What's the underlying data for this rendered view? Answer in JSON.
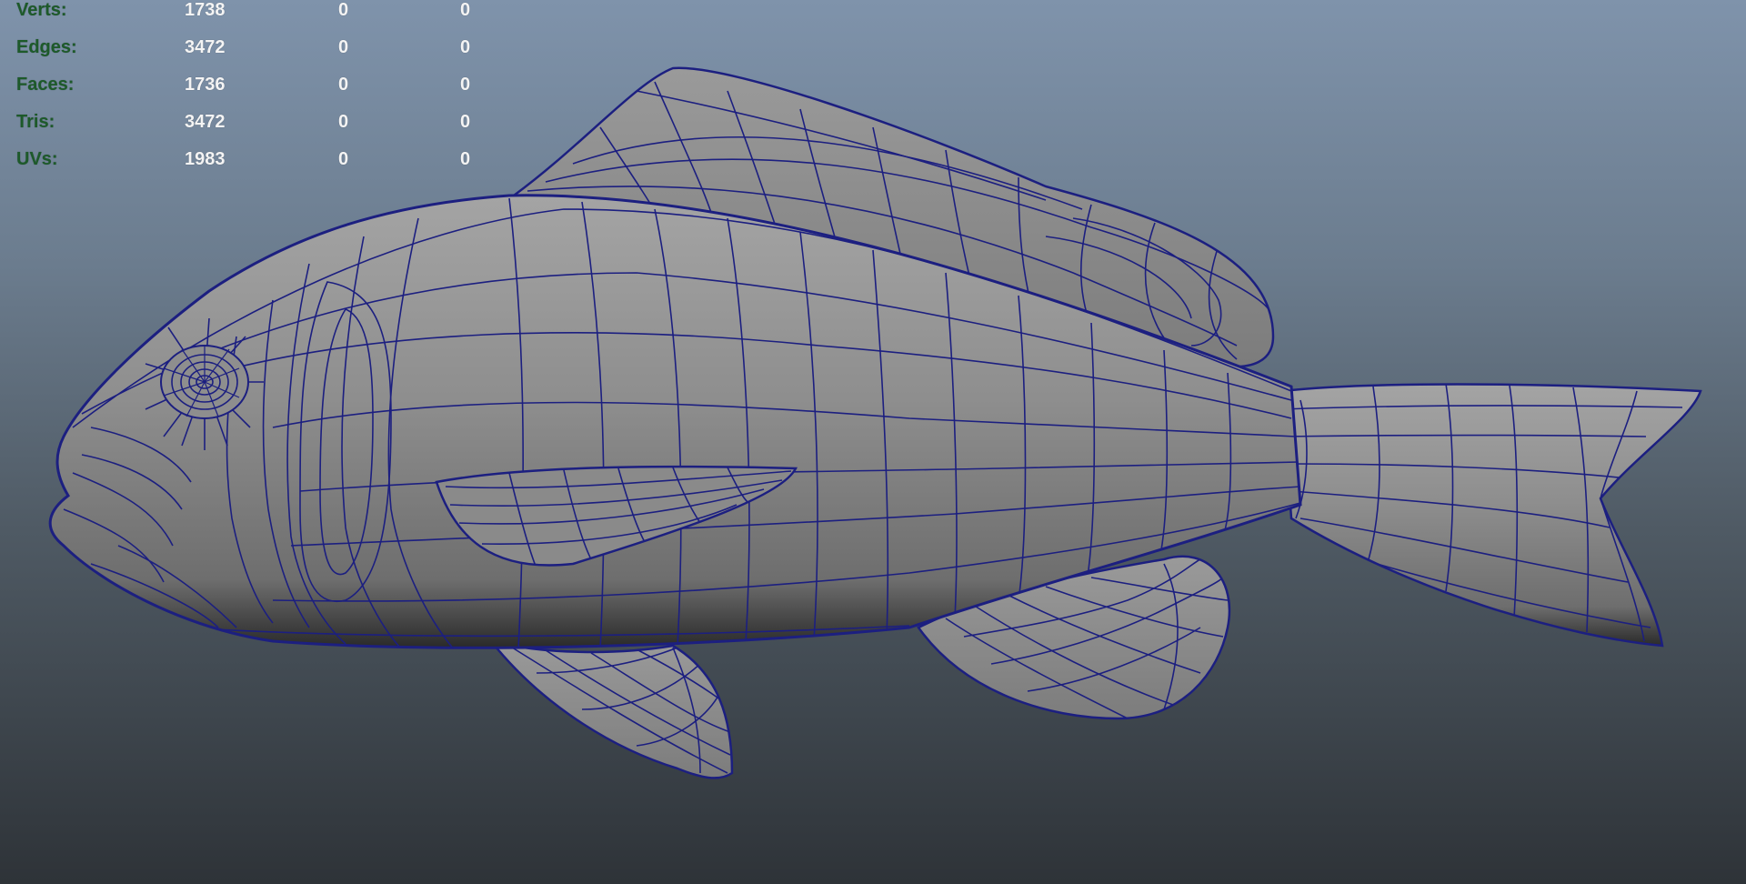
{
  "viewport": {
    "background_top": "#7f93ab",
    "background_bottom": "#2e3338",
    "mesh_fill": "#8c8c8c",
    "wire_color": "#1c1f80"
  },
  "hud": {
    "rows": [
      {
        "label": "Verts:",
        "values": [
          "1738",
          "0",
          "0"
        ]
      },
      {
        "label": "Edges:",
        "values": [
          "3472",
          "0",
          "0"
        ]
      },
      {
        "label": "Faces:",
        "values": [
          "1736",
          "0",
          "0"
        ]
      },
      {
        "label": "Tris:",
        "values": [
          "3472",
          "0",
          "0"
        ]
      },
      {
        "label": "UVs:",
        "values": [
          "1983",
          "0",
          "0"
        ]
      }
    ],
    "label_color": "#1d5a2a",
    "value_color": "#f4f4f4"
  },
  "model": {
    "icon": "fish-mesh"
  }
}
